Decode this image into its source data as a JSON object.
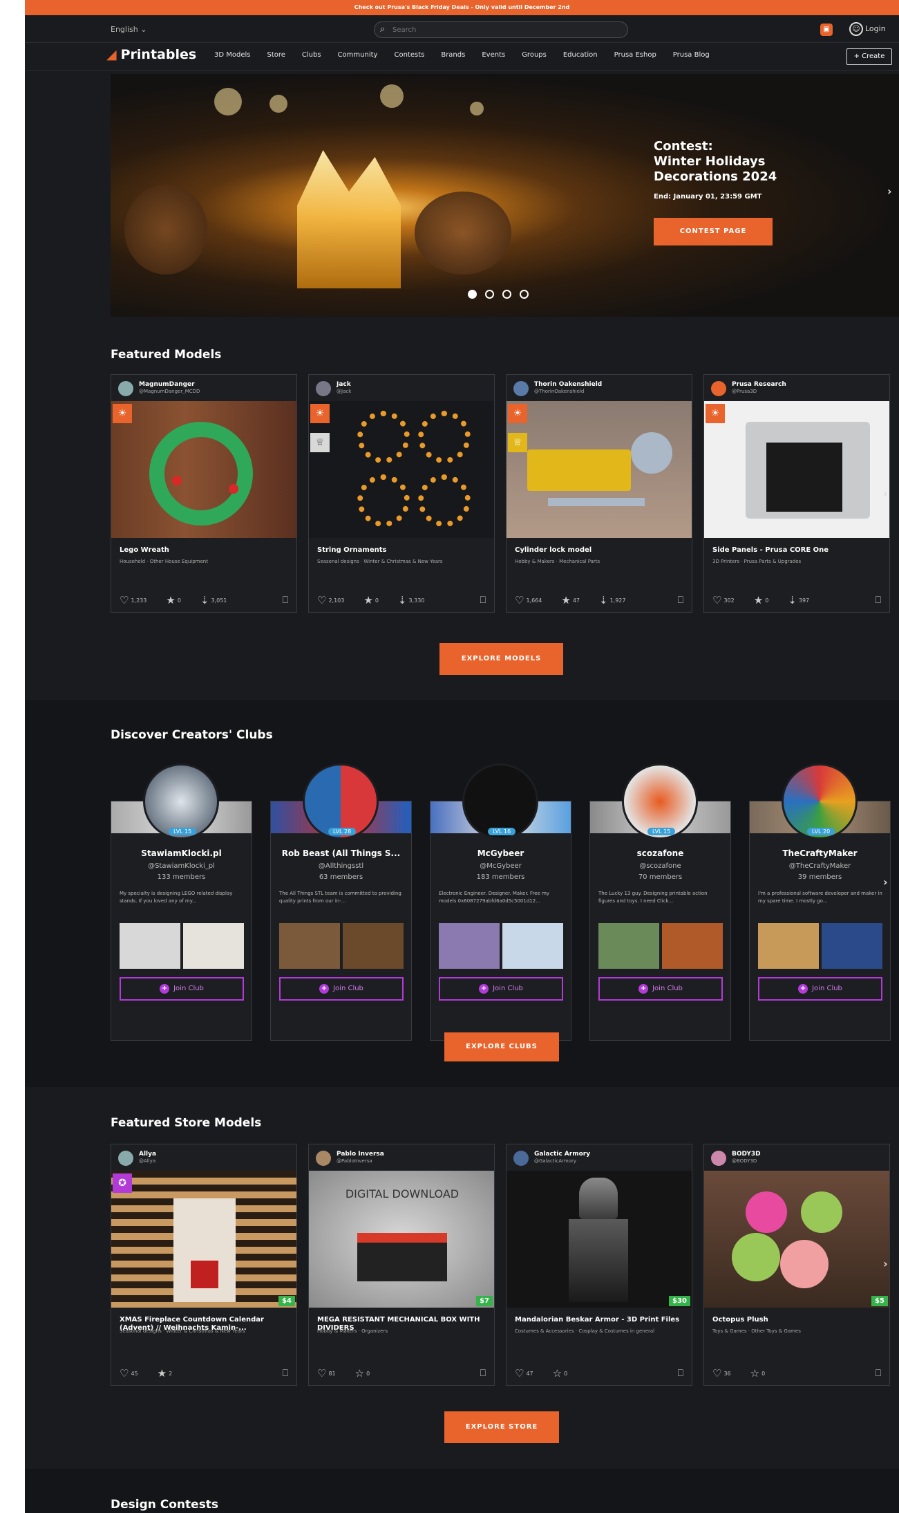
{
  "promo": "Check out Prusa's Black Friday Deals - Only valid until December 2nd",
  "topbar": {
    "language": "English",
    "search_placeholder": "Search",
    "login": "Login"
  },
  "nav": {
    "logo": "Printables",
    "items": [
      "3D Models",
      "Store",
      "Clubs",
      "Community",
      "Contests",
      "Brands",
      "Events",
      "Groups",
      "Education",
      "Prusa Eshop",
      "Prusa Blog"
    ],
    "create": "+ Create"
  },
  "hero": {
    "title_line1": "Contest:",
    "title_line2": "Winter Holidays",
    "title_line3": "Decorations 2024",
    "end": "End: January 01, 23:59 GMT",
    "button": "CONTEST PAGE"
  },
  "featured": {
    "title": "Featured Models",
    "cards": [
      {
        "user": "MagnumDanger",
        "handle": "@MagnumDanger_MCDD",
        "title": "Lego Wreath",
        "cats": "Household  ·  Other House Equipment",
        "likes": "1,233",
        "boosts": "0",
        "downloads": "3,051"
      },
      {
        "user": "Jack",
        "handle": "@Jack",
        "title": "String Ornaments",
        "cats": "Seasonal designs  ·  Winter & Christmas & New Years",
        "likes": "2,103",
        "boosts": "0",
        "downloads": "3,330"
      },
      {
        "user": "Thorin Oakenshield",
        "handle": "@ThorinOakenshield",
        "title": "Cylinder lock model",
        "cats": "Hobby & Makers  ·  Mechanical Parts",
        "likes": "1,664",
        "boosts": "47",
        "downloads": "1,927"
      },
      {
        "user": "Prusa Research",
        "handle": "@Prusa3D",
        "title": "Side Panels - Prusa CORE One",
        "cats": "3D Printers  ·  Prusa Parts & Upgrades",
        "likes": "302",
        "boosts": "0",
        "downloads": "397"
      }
    ],
    "button": "EXPLORE MODELS"
  },
  "clubs": {
    "title": "Discover Creators' Clubs",
    "items": [
      {
        "name": "StawiamKlocki.pl",
        "handle": "@StawiamKlocki_pl",
        "members": "133 members",
        "level": "LVL 15",
        "desc": "My specialty is designing LEGO related display stands. If you loved any of my...",
        "join": "Join Club"
      },
      {
        "name": "Rob Beast (All Things S...",
        "handle": "@Allthingsstl",
        "members": "63 members",
        "level": "LVL 28",
        "desc": "The All Things STL team is committed to providing quality prints from our in-...",
        "join": "Join Club"
      },
      {
        "name": "McGybeer",
        "handle": "@McGybeer",
        "members": "183 members",
        "level": "LVL 16",
        "desc": "Electronic Engineer. Designer. Maker. Free my models 0x6087279abfd6a0d5c5001d12...",
        "join": "Join Club"
      },
      {
        "name": "scozafone",
        "handle": "@scozafone",
        "members": "70 members",
        "level": "LVL 15",
        "desc": "The Lucky 13 guy. Designing printable action figures and toys. I need Click...",
        "join": "Join Club"
      },
      {
        "name": "TheCraftyMaker",
        "handle": "@TheCraftyMaker",
        "members": "39 members",
        "level": "LVL 20",
        "desc": "I'm a professional software developer and maker in my spare time. I mostly go...",
        "join": "Join Club"
      }
    ],
    "button": "EXPLORE CLUBS"
  },
  "store": {
    "title": "Featured Store Models",
    "cards": [
      {
        "user": "Allya",
        "handle": "@Allya",
        "title": "XMAS Fireplace Countdown Calendar (Advent) // Weihnachts Kamin-...",
        "cats": "Seasonal designs  ·  Winter & Christmas & New Years",
        "likes": "45",
        "boosts": "2",
        "price": "$4"
      },
      {
        "user": "Pablo Inversa",
        "handle": "@PabloInversa",
        "title": "MEGA RESISTANT MECHANICAL BOX WITH DIVIDERS",
        "cats": "Hobby & Makers  ·  Organizers",
        "likes": "81",
        "boosts": "0",
        "price": "$7",
        "img_text": "DIGITAL DOWNLOAD"
      },
      {
        "user": "Galactic Armory",
        "handle": "@GalacticArmory",
        "title": "Mandalorian Beskar Armor - 3D Print Files",
        "cats": "Costumes & Accessories  ·  Cosplay & Costumes in general",
        "likes": "47",
        "boosts": "0",
        "price": "$30"
      },
      {
        "user": "BODY3D",
        "handle": "@BODY3D",
        "title": "Octopus Plush",
        "cats": "Toys & Games  ·  Other Toys & Games",
        "likes": "36",
        "boosts": "0",
        "price": "$5"
      }
    ],
    "button": "EXPLORE STORE"
  },
  "contests": {
    "title": "Design Contests"
  },
  "colors": {
    "accent": "#e8642c",
    "bg": "#1a1b1e",
    "club": "#b23bd8",
    "price": "#36b34a"
  }
}
